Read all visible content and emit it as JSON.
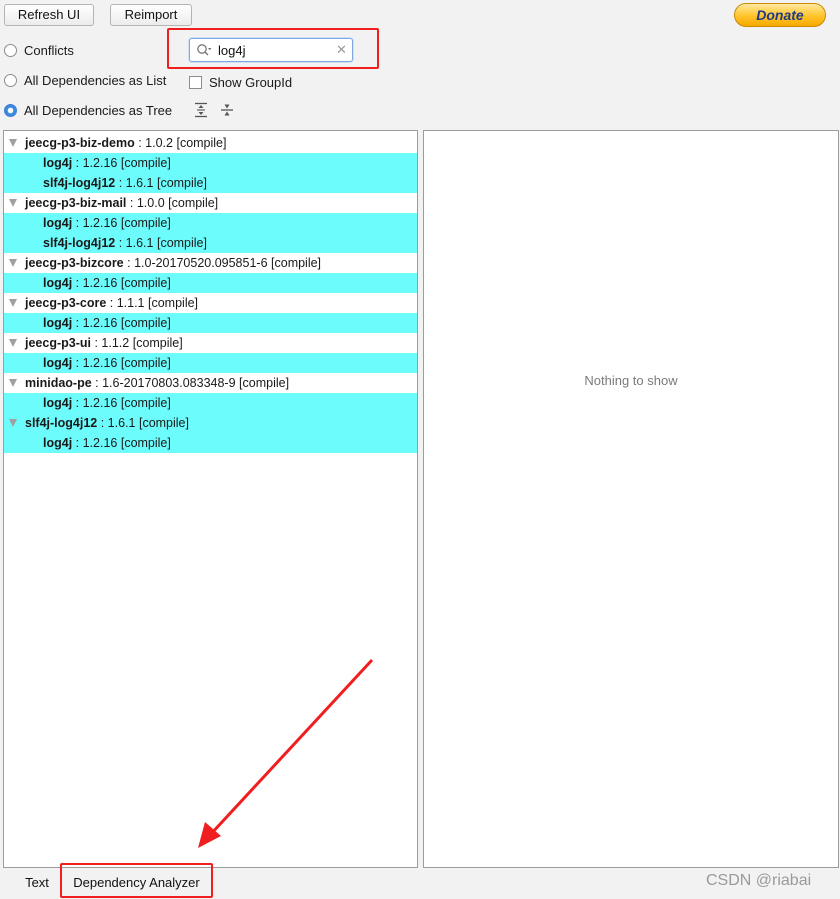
{
  "toolbar": {
    "refresh_label": "Refresh UI",
    "reimport_label": "Reimport",
    "donate_label": "Donate"
  },
  "view_modes": [
    {
      "label": "Conflicts",
      "selected": false
    },
    {
      "label": "All Dependencies as List",
      "selected": false
    },
    {
      "label": "All Dependencies as Tree",
      "selected": true
    }
  ],
  "show_groupid": {
    "label": "Show GroupId",
    "checked": false
  },
  "search": {
    "value": "log4j"
  },
  "tree": [
    {
      "name": "jeecg-p3-biz-demo",
      "version": "1.0.2",
      "scope": "[compile]",
      "children": [
        {
          "name": "log4j",
          "version": "1.2.16",
          "scope": "[compile]"
        },
        {
          "name": "slf4j-log4j12",
          "version": "1.6.1",
          "scope": "[compile]"
        }
      ]
    },
    {
      "name": "jeecg-p3-biz-mail",
      "version": "1.0.0",
      "scope": "[compile]",
      "children": [
        {
          "name": "log4j",
          "version": "1.2.16",
          "scope": "[compile]"
        },
        {
          "name": "slf4j-log4j12",
          "version": "1.6.1",
          "scope": "[compile]"
        }
      ]
    },
    {
      "name": "jeecg-p3-bizcore",
      "version": "1.0-20170520.095851-6",
      "scope": "[compile]",
      "children": [
        {
          "name": "log4j",
          "version": "1.2.16",
          "scope": "[compile]"
        }
      ]
    },
    {
      "name": "jeecg-p3-core",
      "version": "1.1.1",
      "scope": "[compile]",
      "children": [
        {
          "name": "log4j",
          "version": "1.2.16",
          "scope": "[compile]"
        }
      ]
    },
    {
      "name": "jeecg-p3-ui",
      "version": "1.1.2",
      "scope": "[compile]",
      "children": [
        {
          "name": "log4j",
          "version": "1.2.16",
          "scope": "[compile]"
        }
      ]
    },
    {
      "name": "minidao-pe",
      "version": "1.6-20170803.083348-9",
      "scope": "[compile]",
      "children": [
        {
          "name": "log4j",
          "version": "1.2.16",
          "scope": "[compile]"
        }
      ]
    },
    {
      "name": "slf4j-log4j12",
      "version": "1.6.1",
      "scope": "[compile]",
      "highlight": true,
      "children": [
        {
          "name": "log4j",
          "version": "1.2.16",
          "scope": "[compile]"
        }
      ]
    }
  ],
  "detail_panel": {
    "empty_message": "Nothing to show"
  },
  "bottom_tabs": [
    {
      "label": "Text",
      "active": false
    },
    {
      "label": "Dependency Analyzer",
      "active": true
    }
  ],
  "watermark": "CSDN @riabai",
  "colors": {
    "highlight": "#6cfcfc",
    "annotation_red": "#f01e1e",
    "radio_selected": "#3d8ae0"
  }
}
